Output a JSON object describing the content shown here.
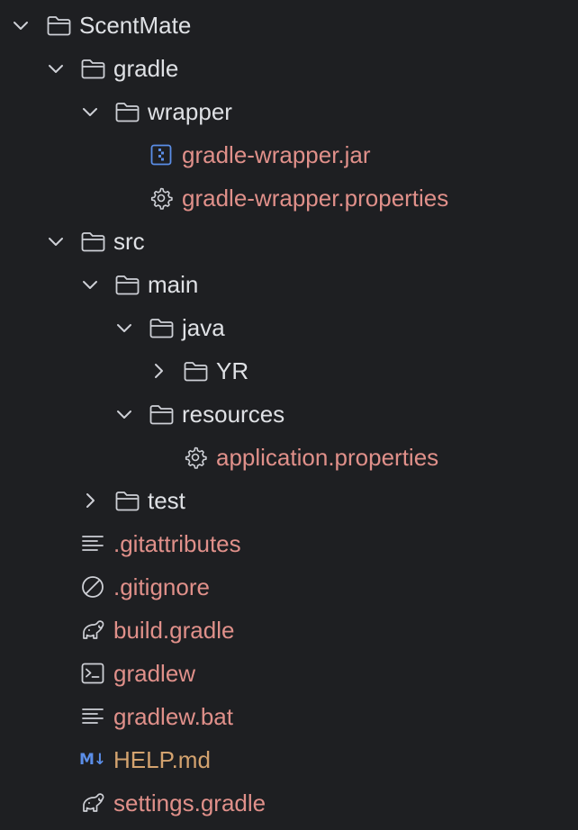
{
  "project_tree": {
    "root": {
      "label": "ScentMate",
      "expanded": true
    },
    "gradle": {
      "label": "gradle",
      "expanded": true
    },
    "wrapper": {
      "label": "wrapper",
      "expanded": true
    },
    "wrapper_jar": {
      "label": "gradle-wrapper.jar",
      "icon": "jar-icon"
    },
    "wrapper_props": {
      "label": "gradle-wrapper.properties",
      "icon": "gear-icon"
    },
    "src": {
      "label": "src",
      "expanded": true
    },
    "main": {
      "label": "main",
      "expanded": true
    },
    "java": {
      "label": "java",
      "expanded": true
    },
    "yr": {
      "label": "YR",
      "expanded": false
    },
    "resources": {
      "label": "resources",
      "expanded": true
    },
    "app_props": {
      "label": "application.properties",
      "icon": "gear-icon"
    },
    "test": {
      "label": "test",
      "expanded": false
    },
    "gitattributes": {
      "label": ".gitattributes",
      "icon": "text-file-icon"
    },
    "gitignore": {
      "label": ".gitignore",
      "icon": "ignore-icon"
    },
    "build_gradle": {
      "label": "build.gradle",
      "icon": "gradle-icon"
    },
    "gradlew": {
      "label": "gradlew",
      "icon": "terminal-icon"
    },
    "gradlew_bat": {
      "label": "gradlew.bat",
      "icon": "text-file-icon"
    },
    "help_md": {
      "label": "HELP.md",
      "icon": "markdown-icon",
      "icon_text": "M↓"
    },
    "settings_gradle": {
      "label": "settings.gradle",
      "icon": "gradle-icon"
    }
  },
  "colors": {
    "background": "#1e1f22",
    "text_default": "#dfe1e5",
    "text_modified": "#e0908a",
    "text_markdown": "#d4a36f",
    "icon_gray": "#ced0d6",
    "icon_blue": "#5b8ee8"
  }
}
